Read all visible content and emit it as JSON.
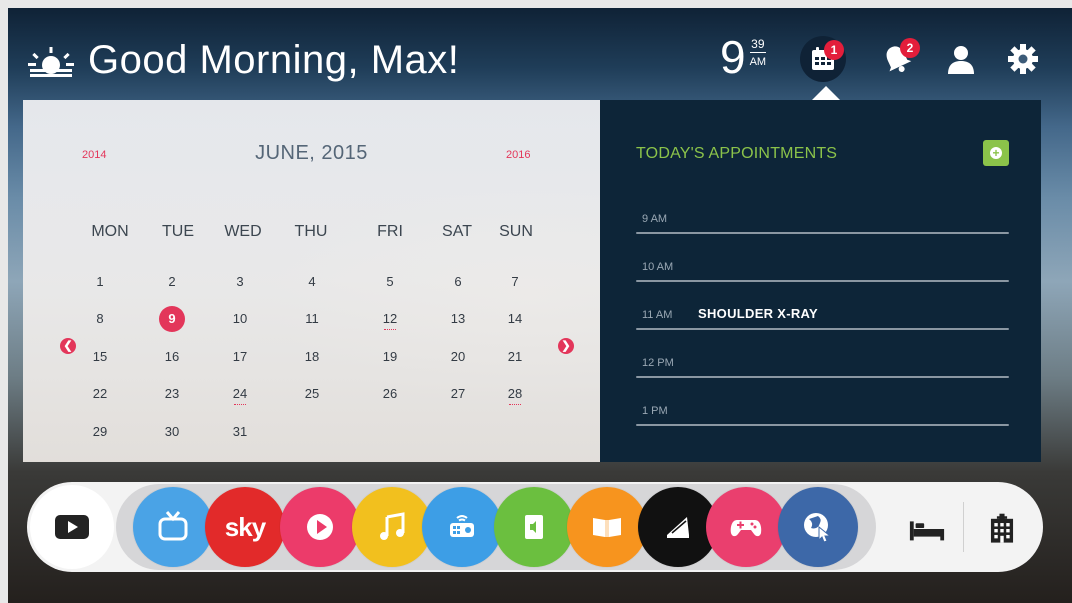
{
  "header": {
    "greeting": "Good Morning, Max!",
    "weather_icon": "sunrise-icon",
    "clock": {
      "hour": "9",
      "minutes": "39",
      "ampm": "AM"
    },
    "calendar_badge": "1",
    "notifications_badge": "2",
    "icons": [
      "calendar-icon",
      "bell-icon",
      "user-icon",
      "gear-icon"
    ]
  },
  "calendar": {
    "month_label": "JUNE, 2015",
    "prev_year": "2014",
    "next_year": "2016",
    "weekdays": [
      "MON",
      "TUE",
      "WED",
      "THU",
      "FRI",
      "SAT",
      "SUN"
    ],
    "weeks": [
      [
        "1",
        "2",
        "3",
        "4",
        "5",
        "6",
        "7"
      ],
      [
        "8",
        "9",
        "10",
        "11",
        "12",
        "13",
        "14"
      ],
      [
        "15",
        "16",
        "17",
        "18",
        "19",
        "20",
        "21"
      ],
      [
        "22",
        "23",
        "24",
        "25",
        "26",
        "27",
        "28"
      ],
      [
        "29",
        "30",
        "31",
        "",
        "",
        "",
        ""
      ]
    ],
    "selected_day": "9",
    "marked_days": [
      "12",
      "24",
      "28"
    ],
    "accent_color": "#e3365a"
  },
  "appointments": {
    "title": "TODAY'S APPOINTMENTS",
    "accent_color": "#8bc34a",
    "slots": [
      {
        "time": "9 AM",
        "event": ""
      },
      {
        "time": "10 AM",
        "event": ""
      },
      {
        "time": "11 AM",
        "event": "SHOULDER  X-RAY"
      },
      {
        "time": "12 PM",
        "event": ""
      },
      {
        "time": "1 PM",
        "event": ""
      }
    ]
  },
  "dock": {
    "home_icon": "play-icon",
    "apps": [
      {
        "name": "tv",
        "icon": "tv-icon",
        "color": "#4aa3e6"
      },
      {
        "name": "sky",
        "label": "sky",
        "color": "#e22a2a"
      },
      {
        "name": "video",
        "icon": "play-circle-icon",
        "color": "#ec3b6a"
      },
      {
        "name": "music",
        "icon": "music-note-icon",
        "color": "#f2c01e"
      },
      {
        "name": "remote",
        "icon": "remote-icon",
        "color": "#3d9ee6"
      },
      {
        "name": "audio-book",
        "icon": "speaker-book-icon",
        "color": "#6bbf3f"
      },
      {
        "name": "books",
        "icon": "open-book-icon",
        "color": "#f7941e"
      },
      {
        "name": "magazine",
        "icon": "magazine-icon",
        "color": "#111111"
      },
      {
        "name": "games",
        "icon": "gamepad-icon",
        "color": "#ea3f6e"
      },
      {
        "name": "browser",
        "icon": "globe-cursor-icon",
        "color": "#3d68a8"
      }
    ],
    "right_icons": [
      "bed-icon",
      "hospital-icon"
    ]
  }
}
